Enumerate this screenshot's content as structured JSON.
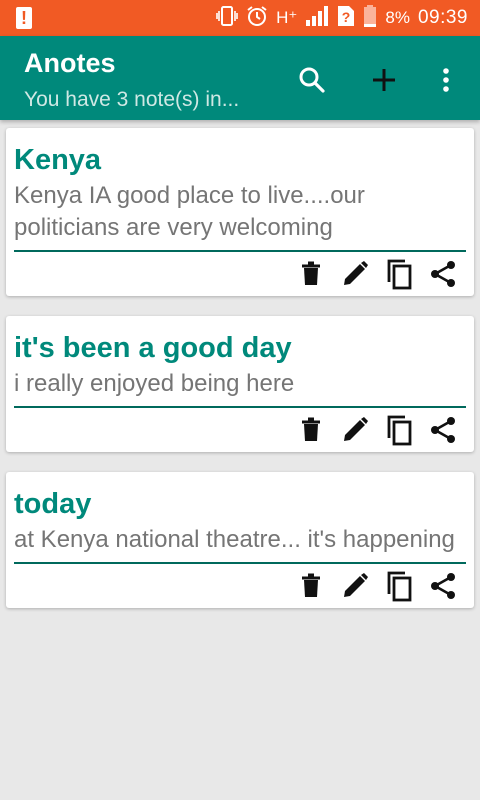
{
  "status_bar": {
    "network": "H⁺",
    "battery": "8%",
    "time": "09:39"
  },
  "appbar": {
    "title": "Anotes",
    "subtitle": "You have 3 note(s) in..."
  },
  "notes": [
    {
      "title": "Kenya",
      "body": "Kenya IA good place to live....our politicians are very welcoming"
    },
    {
      "title": "it's been a good day",
      "body": "i really enjoyed being here"
    },
    {
      "title": "today",
      "body": "at Kenya national theatre... it's happening"
    }
  ],
  "colors": {
    "status_bar": "#f15a24",
    "primary": "#00897b",
    "divider": "#00695c",
    "body_text": "#757575",
    "background": "#e8e8e8"
  },
  "icons": {
    "appbar": [
      "search-icon",
      "add-icon",
      "more-vert-icon"
    ],
    "note_actions": [
      "delete-icon",
      "edit-icon",
      "copy-icon",
      "share-icon"
    ]
  }
}
